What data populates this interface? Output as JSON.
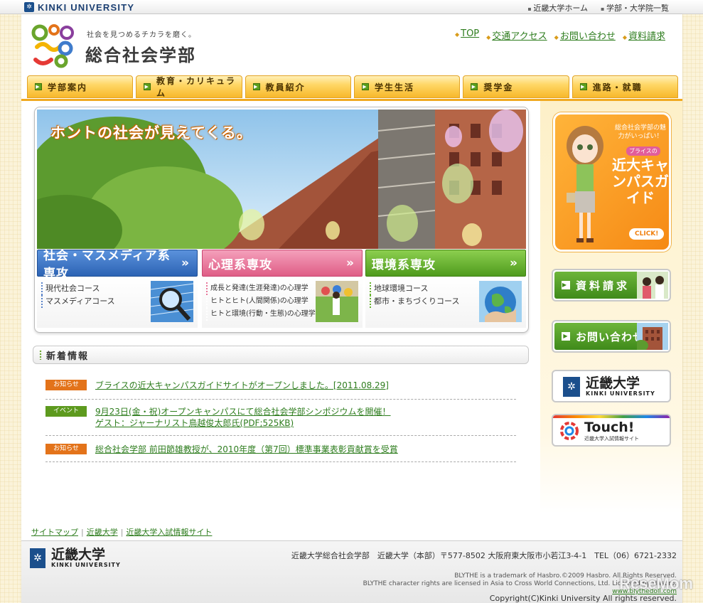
{
  "topbar": {
    "brand": "KINKI UNIVERSITY",
    "links": [
      "近畿大学ホーム",
      "学部・大学院一覧"
    ]
  },
  "header": {
    "tagline": "社会を見つめるチカラを磨く。",
    "faculty": "総合社会学部",
    "links": [
      "TOP",
      "交通アクセス",
      "お問い合わせ",
      "資料請求"
    ]
  },
  "nav": [
    "学部案内",
    "教育・カリキュラム",
    "教員紹介",
    "学生生活",
    "奨学金",
    "進路・就職"
  ],
  "hero": {
    "title": "ホントの社会が見えてくる。",
    "majors": [
      {
        "name": "社会・マスメディア系専攻",
        "color": "#3f7ccc",
        "lines": [
          "現代社会コース",
          "マスメディアコース"
        ]
      },
      {
        "name": "心理系専攻",
        "color": "#e8769a",
        "lines": [
          "成長と発達(生涯発達)の心理学",
          "ヒトとヒト(人間関係)の心理学",
          "ヒトと環境(行動・生態)の心理学"
        ]
      },
      {
        "name": "環境系専攻",
        "color": "#68b230",
        "lines": [
          "地球環境コース",
          "都市・まちづくりコース"
        ]
      }
    ]
  },
  "sidebar": {
    "doll": {
      "small": "総合社会学部の魅力がいっぱい！",
      "blythe": "ブライスの",
      "big": "近大キャンパスガイド",
      "click": "CLICK!"
    },
    "request": "資料請求",
    "contact": "お問い合わせ",
    "ku_jp": "近畿大学",
    "ku_en": "KINKI UNIVERSITY",
    "touch": "Touch!",
    "touch_sub": "近畿大学入試情報サイト"
  },
  "news": {
    "heading": "新着情報",
    "items": [
      {
        "badge": "お知らせ",
        "badge_color": "#e3731a",
        "lines": [
          "ブライスの近大キャンパスガイドサイトがオープンしました。[2011.08.29]"
        ]
      },
      {
        "badge": "イベント",
        "badge_color": "#5d9a1e",
        "lines": [
          "9月23日(金・祝)オープンキャンパスにて総合社会学部シンポジウムを開催！",
          "ゲスト：ジャーナリスト鳥越俊太郎氏(PDF;525KB)"
        ]
      },
      {
        "badge": "お知らせ",
        "badge_color": "#e3731a",
        "lines": [
          "総合社会学部 前田節雄教授が、2010年度（第7回）標準事業表彰貢献賞を受賞"
        ]
      }
    ]
  },
  "footer": {
    "links": [
      "サイトマップ",
      "近畿大学",
      "近畿大学入試情報サイト"
    ],
    "logo_jp": "近畿大学",
    "logo_en": "KINKI UNIVERSITY",
    "address": "近畿大学総合社会学部　近畿大学（本部）〒577-8502 大阪府東大阪市小若江3-4-1　TEL（06）6721-2332",
    "legal1": "BLYTHE is a trademark of Hasbro.©2009 Hasbro. All Rights Reserved.",
    "legal2": "BLYTHE character rights are licensed in Asia to Cross World Connections, Ltd. Licensed by Hasbro.",
    "legal_link": "www.blythedoll.com",
    "copyright": "Copyright(C)Kinki University All rights reserved.",
    "watermark": "ReseMom"
  }
}
